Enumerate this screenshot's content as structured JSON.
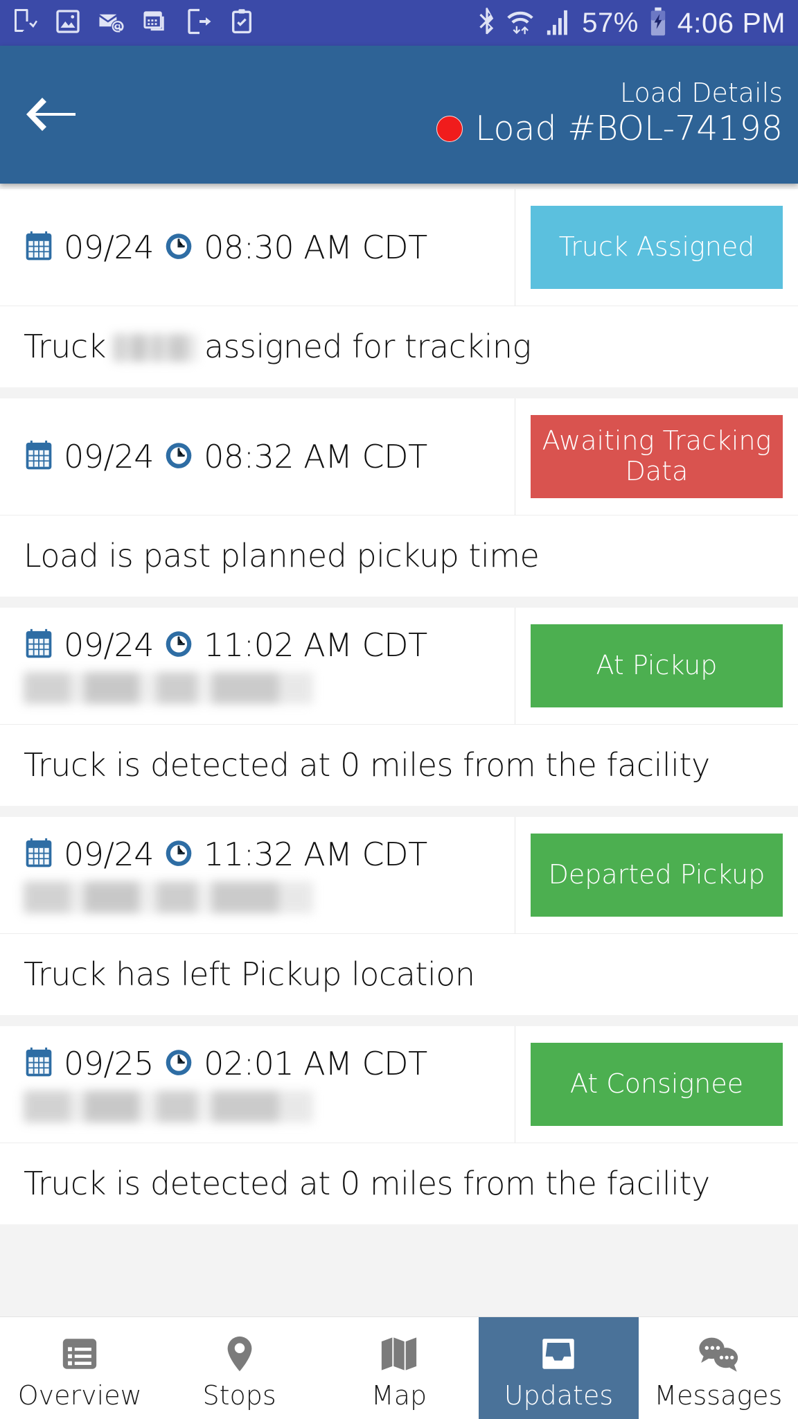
{
  "statusbar": {
    "notification_icons": [
      "tablet-download-icon",
      "image-icon",
      "mail-at-icon",
      "calendar-icon",
      "phone-arrow-icon",
      "clipboard-check-icon"
    ],
    "bluetooth_icon": "bluetooth-icon",
    "wifi_icon": "wifi-transfer-icon",
    "signal_icon": "cellular-signal-icon",
    "battery_percent": "57%",
    "battery_icon": "battery-charging-icon",
    "time": "4:06 PM"
  },
  "header": {
    "back_icon": "back-arrow-icon",
    "subtitle": "Load Details",
    "status_dot_color": "#f01c1c",
    "title": "Load #BOL-74198",
    "background_color": "#2e6396"
  },
  "colors": {
    "badge_info": "#5bc0de",
    "badge_danger": "#d9534f",
    "badge_success": "#4caf50",
    "nav_active": "#4a7299"
  },
  "events": [
    {
      "calendar_icon": "calendar-icon",
      "date": "09/24",
      "clock_icon": "clock-icon",
      "time": "08:30 AM CDT",
      "location": "",
      "location_redacted": false,
      "badge_label": "Truck Assigned",
      "badge_color": "#5bc0de",
      "desc_prefix": "Truck",
      "desc_redacted": true,
      "desc_suffix": "assigned for tracking",
      "description": "Truck assigned for tracking"
    },
    {
      "calendar_icon": "calendar-icon",
      "date": "09/24",
      "clock_icon": "clock-icon",
      "time": "08:32 AM CDT",
      "location": "",
      "location_redacted": false,
      "badge_label": "Awaiting Tracking Data",
      "badge_color": "#d9534f",
      "desc_prefix": "",
      "desc_redacted": false,
      "desc_suffix": "",
      "description": "Load is past planned pickup time"
    },
    {
      "calendar_icon": "calendar-icon",
      "date": "09/24",
      "clock_icon": "clock-icon",
      "time": "11:02 AM CDT",
      "location": "",
      "location_redacted": true,
      "badge_label": "At Pickup",
      "badge_color": "#4caf50",
      "desc_prefix": "",
      "desc_redacted": false,
      "desc_suffix": "",
      "description": "Truck is detected at 0 miles from the facility"
    },
    {
      "calendar_icon": "calendar-icon",
      "date": "09/24",
      "clock_icon": "clock-icon",
      "time": "11:32 AM CDT",
      "location": "",
      "location_redacted": true,
      "badge_label": "Departed Pickup",
      "badge_color": "#4caf50",
      "desc_prefix": "",
      "desc_redacted": false,
      "desc_suffix": "",
      "description": "Truck has left Pickup location"
    },
    {
      "calendar_icon": "calendar-icon",
      "date": "09/25",
      "clock_icon": "clock-icon",
      "time": "02:01 AM CDT",
      "location": "",
      "location_redacted": true,
      "badge_label": "At Consignee",
      "badge_color": "#4caf50",
      "desc_prefix": "",
      "desc_redacted": false,
      "desc_suffix": "",
      "description": "Truck is detected at 0 miles from the facility"
    }
  ],
  "bottom_nav": {
    "items": [
      {
        "label": "Overview",
        "icon": "list-overview-icon",
        "active": false
      },
      {
        "label": "Stops",
        "icon": "map-pin-icon",
        "active": false
      },
      {
        "label": "Map",
        "icon": "folded-map-icon",
        "active": false
      },
      {
        "label": "Updates",
        "icon": "inbox-icon",
        "active": true
      },
      {
        "label": "Messages",
        "icon": "chat-bubbles-icon",
        "active": false
      }
    ]
  }
}
